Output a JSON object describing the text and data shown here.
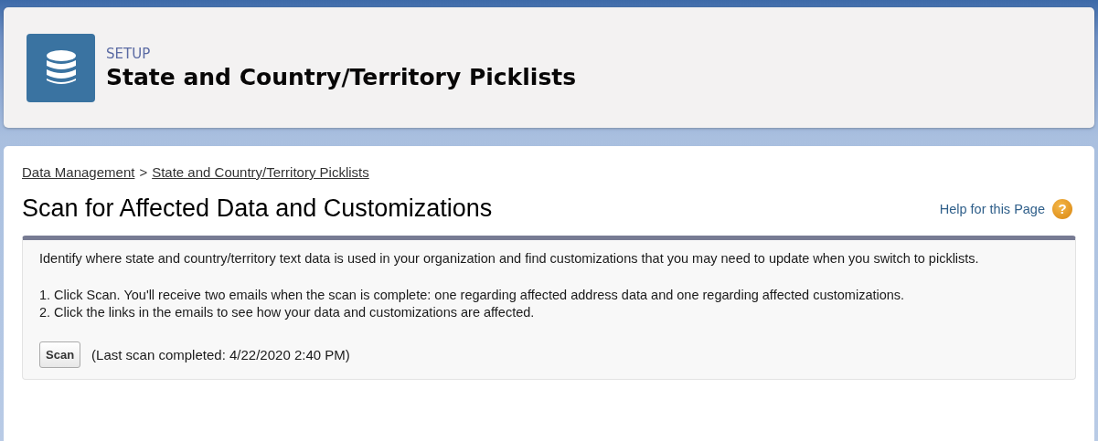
{
  "header": {
    "eyebrow": "SETUP",
    "title": "State and Country/Territory Picklists"
  },
  "breadcrumb": [
    {
      "label": "Data Management"
    },
    {
      "label": "State and Country/Territory Picklists"
    }
  ],
  "breadcrumb_separator": ">",
  "page_title": "Scan for Affected Data and Customizations",
  "help": {
    "label": "Help for this Page",
    "icon": "?"
  },
  "panel": {
    "intro": "Identify where state and country/territory text data is used in your organization and find customizations that you may need to update when you switch to picklists.",
    "steps": [
      "1. Click Scan. You'll receive two emails when the scan is complete: one regarding affected address data and one regarding affected customizations.",
      "2. Click the links in the emails to see how your data and customizations are affected."
    ],
    "button": "Scan",
    "status": "(Last scan completed: 4/22/2020 2:40 PM)"
  }
}
